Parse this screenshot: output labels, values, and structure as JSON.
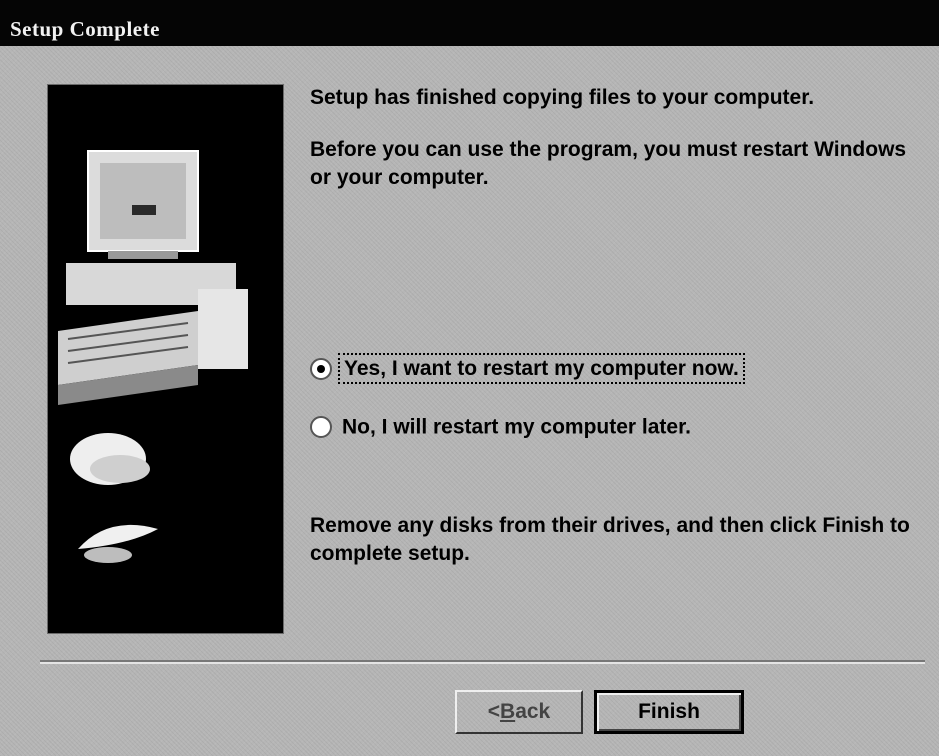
{
  "window": {
    "title": "Setup Complete"
  },
  "content": {
    "message_line1": "Setup has finished copying files to your computer.",
    "message_line2": "Before you can use the program, you must restart Windows or your computer.",
    "restart_options": [
      {
        "label": "Yes, I want to restart my computer now.",
        "selected": true
      },
      {
        "label": "No, I will restart my computer later.",
        "selected": false
      }
    ],
    "instruction": "Remove any disks from their drives, and then click Finish to complete setup."
  },
  "buttons": {
    "back_prefix": "< ",
    "back_accel": "B",
    "back_rest": "ack",
    "finish_label": "Finish"
  },
  "colors": {
    "titlebar": "#050505",
    "dialog_bg": "#b6b6b6",
    "side_panel_bg": "#000000"
  },
  "icons": {
    "side_image": "computer-and-disks-illustration"
  }
}
